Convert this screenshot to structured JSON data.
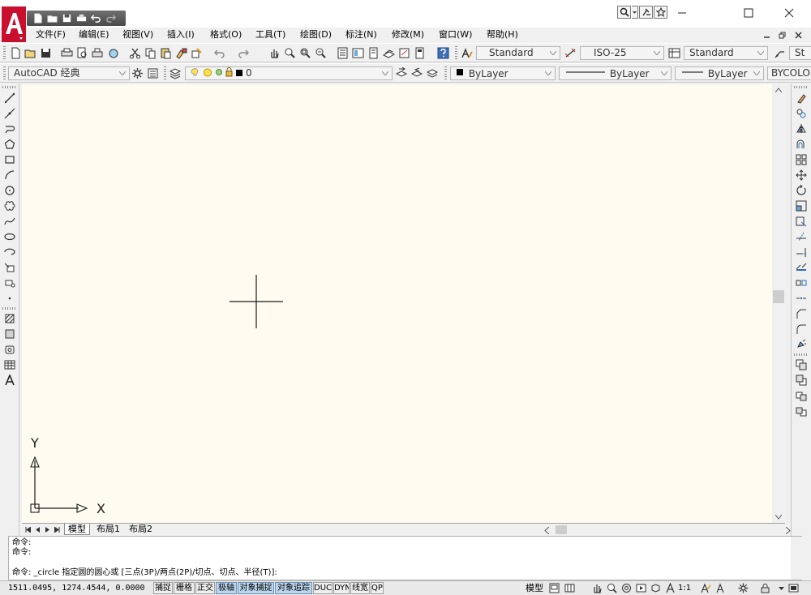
{
  "titlebar": {
    "qat_icons": [
      "new-icon",
      "open-icon",
      "save-icon",
      "print-icon",
      "undo-icon",
      "redo-icon"
    ],
    "info_icons": [
      "search-icon",
      "communication-center-icon",
      "favorites-star-icon"
    ],
    "controls": [
      "minimize-icon",
      "maximize-icon",
      "close-icon"
    ]
  },
  "menubar": {
    "items": [
      "文件(F)",
      "编辑(E)",
      "视图(V)",
      "插入(I)",
      "格式(O)",
      "工具(T)",
      "绘图(D)",
      "标注(N)",
      "修改(M)",
      "窗口(W)",
      "帮助(H)"
    ]
  },
  "toolbar_standard": {
    "text_style": "Standard",
    "dim_style": "ISO-25",
    "table_style": "Standard",
    "multileader_style": "St"
  },
  "toolbar_layers": {
    "workspace": "AutoCAD 经典",
    "current_layer": "0",
    "color": "ByLayer",
    "linetype": "ByLayer",
    "lineweight": "ByLayer",
    "plot_style": "BYCOLOR"
  },
  "ucs": {
    "x_label": "X",
    "y_label": "Y"
  },
  "layout_tabs": [
    "模型",
    "布局1",
    "布局2"
  ],
  "command_window": {
    "lines": [
      "命令:",
      "命令:",
      "命令: _circle 指定圆的圆心或 [三点(3P)/两点(2P)/切点、切点、半径(T)]:"
    ]
  },
  "statusbar": {
    "coords": "1511.0495, 1274.4544, 0.0000",
    "toggles": [
      {
        "label": "捕捉",
        "on": false
      },
      {
        "label": "栅格",
        "on": false
      },
      {
        "label": "正交",
        "on": false
      },
      {
        "label": "极轴",
        "on": true
      },
      {
        "label": "对象捕捉",
        "on": true
      },
      {
        "label": "对象追踪",
        "on": true
      },
      {
        "label": "DUCS",
        "on": false
      },
      {
        "label": "DYN",
        "on": false
      },
      {
        "label": "线宽",
        "on": false
      },
      {
        "label": "QP",
        "on": false
      }
    ],
    "model": "模型",
    "scale": "1:1"
  },
  "colors": {
    "canvas_bg": "#fffbf0",
    "logo_red": "#c8102e",
    "toggle_on": "#bcd6ee"
  }
}
